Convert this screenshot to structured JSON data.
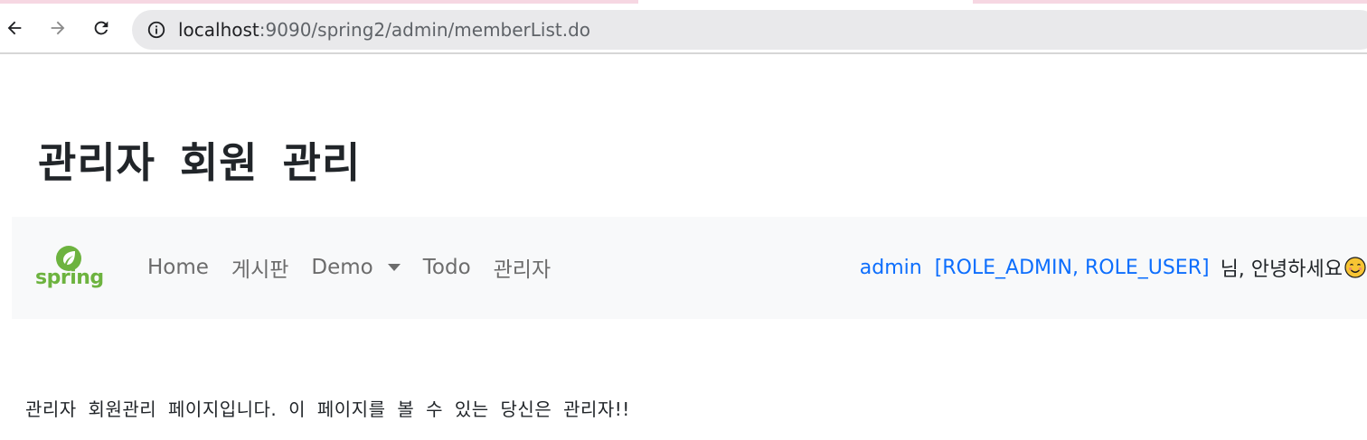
{
  "browser": {
    "url_host": "localhost",
    "url_rest": ":9090/spring2/admin/memberList.do",
    "back_icon": "arrow-left-icon",
    "forward_icon": "arrow-right-icon",
    "reload_icon": "reload-icon",
    "info_icon": "info-icon"
  },
  "page": {
    "title": "관리자 회원 관리"
  },
  "navbar": {
    "brand": "spring",
    "brand_icon": "spring-leaf-icon",
    "links": {
      "home": "Home",
      "board": "게시판",
      "demo": "Demo",
      "todo": "Todo",
      "admin": "관리자"
    },
    "user": {
      "name": "admin",
      "roles": "[ROLE_ADMIN, ROLE_USER]",
      "greeting": "님, 안녕하세요",
      "emoji_icon": "smiley-icon"
    }
  },
  "content": {
    "message": "관리자 회원관리 페이지입니다. 이 페이지를 볼 수 있는 당신은 관리자!!"
  },
  "colors": {
    "accent": "#0d6efd",
    "brand": "#6db33f",
    "navbar_bg": "#f8f9fa"
  }
}
